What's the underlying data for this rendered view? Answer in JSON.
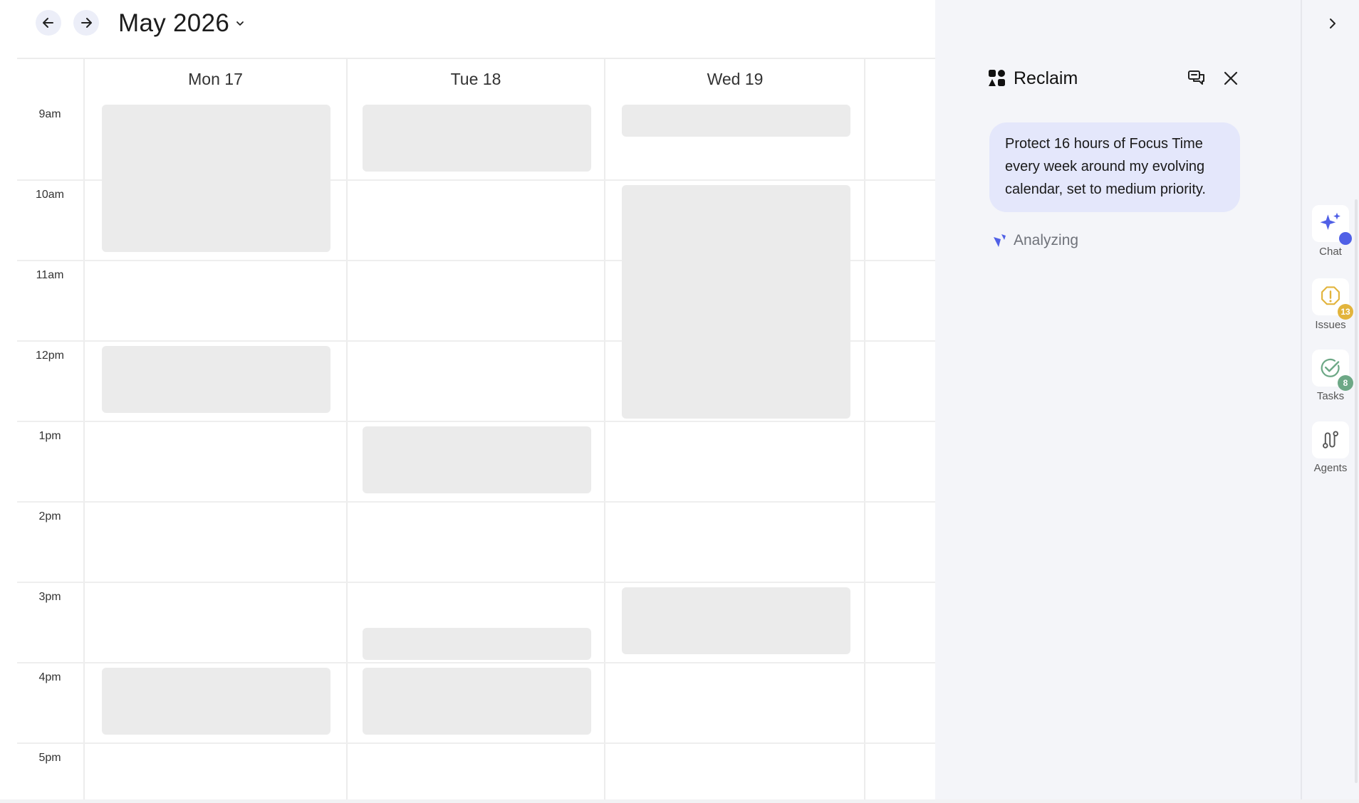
{
  "calendar": {
    "month_label": "May 2026",
    "days": [
      {
        "label": "Mon 17"
      },
      {
        "label": "Tue 18"
      },
      {
        "label": "Wed 19"
      }
    ],
    "hours": [
      "9am",
      "10am",
      "11am",
      "12pm",
      "1pm",
      "2pm",
      "3pm",
      "4pm",
      "5pm"
    ],
    "events": [
      {
        "day": 0,
        "start": 9.0,
        "end": 10.83
      },
      {
        "day": 0,
        "start": 12.0,
        "end": 12.83
      },
      {
        "day": 0,
        "start": 16.0,
        "end": 16.83
      },
      {
        "day": 1,
        "start": 9.0,
        "end": 9.83
      },
      {
        "day": 1,
        "start": 13.0,
        "end": 13.83
      },
      {
        "day": 1,
        "start": 15.5,
        "end": 15.9
      },
      {
        "day": 1,
        "start": 16.0,
        "end": 16.83
      },
      {
        "day": 2,
        "start": 9.0,
        "end": 9.4
      },
      {
        "day": 2,
        "start": 10.0,
        "end": 12.9
      },
      {
        "day": 2,
        "start": 15.0,
        "end": 15.83
      }
    ],
    "event_color": "#ebebeb"
  },
  "assistant": {
    "title": "Reclaim",
    "message": "Protect 16 hours of Focus Time every week around my evolving calendar, set to medium priority.",
    "status": "Analyzing",
    "accent": "#5060e6"
  },
  "rail": {
    "items": [
      {
        "label": "Chat",
        "icon": "sparkle-icon"
      },
      {
        "label": "Issues",
        "icon": "alert-icon",
        "badge": "13",
        "badge_color": "#e2b43c"
      },
      {
        "label": "Tasks",
        "icon": "check-icon",
        "badge": "8",
        "badge_color": "#6da886"
      },
      {
        "label": "Agents",
        "icon": "route-icon"
      }
    ]
  }
}
